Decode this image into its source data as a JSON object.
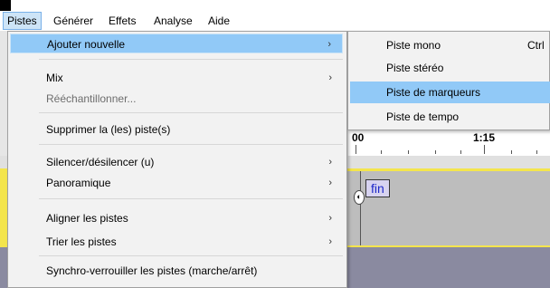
{
  "menubar": {
    "items": [
      {
        "label": "Pistes",
        "active": true
      },
      {
        "label": "Générer"
      },
      {
        "label": "Effets"
      },
      {
        "label": "Analyse"
      },
      {
        "label": "Aide"
      }
    ]
  },
  "tracks_menu": {
    "items": [
      {
        "label": "Ajouter nouvelle",
        "submenu_arrow": "›",
        "highlighted": true
      },
      {
        "label": "Mix",
        "submenu_arrow": "›"
      },
      {
        "label": "Rééchantillonner...",
        "disabled": true
      },
      {
        "label": "Supprimer la (les) piste(s)"
      },
      {
        "label": "Silencer/désilencer (u)",
        "submenu_arrow": "›"
      },
      {
        "label": "Panoramique",
        "submenu_arrow": "›"
      },
      {
        "label": "Aligner les pistes",
        "submenu_arrow": "›"
      },
      {
        "label": "Trier les pistes",
        "submenu_arrow": "›"
      },
      {
        "label": "Synchro-verrouiller les pistes (marche/arrêt)"
      }
    ]
  },
  "add_new_submenu": {
    "items": [
      {
        "label": "Piste mono",
        "shortcut": "Ctrl"
      },
      {
        "label": "Piste stéréo"
      },
      {
        "label": "Piste de marqueurs",
        "highlighted": true
      },
      {
        "label": "Piste de tempo"
      }
    ]
  },
  "timeline": {
    "ruler_labels": [
      "00",
      "1:15"
    ]
  },
  "label_track": {
    "label_text": "fin"
  },
  "colors": {
    "highlight": "#91c9f7",
    "track_yellow": "#f4e54c",
    "label_text": "#1e28c8",
    "label_bg": "#d7d3f0"
  }
}
